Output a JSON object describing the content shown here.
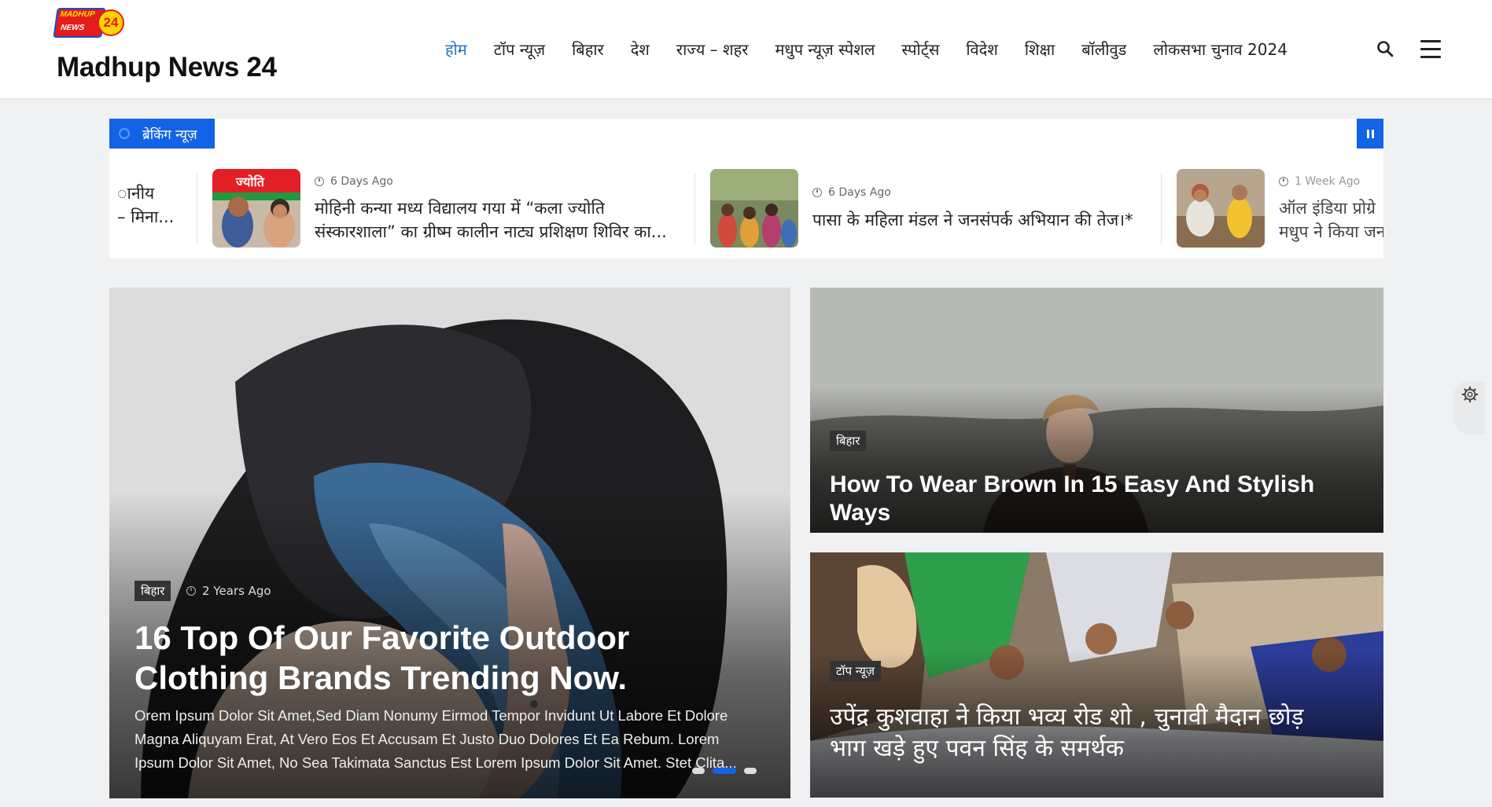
{
  "header": {
    "logo": {
      "line1": "MADHUP",
      "line2": "NEWS",
      "number": "24"
    },
    "site_title": "Madhup News 24",
    "nav": [
      {
        "label": "होम",
        "active": true
      },
      {
        "label": "टॉप न्यूज़"
      },
      {
        "label": "बिहार"
      },
      {
        "label": "देश"
      },
      {
        "label": "राज्य – शहर"
      },
      {
        "label": "मधुप न्यूज़ स्पेशल"
      },
      {
        "label": "स्पोर्ट्स"
      },
      {
        "label": "विदेश"
      },
      {
        "label": "शिक्षा"
      },
      {
        "label": "बॉलीवुड"
      },
      {
        "label": "लोकसभा चुनाव 2024"
      }
    ],
    "icons": [
      "search-icon",
      "menu-icon"
    ]
  },
  "breaking": {
    "label": "ब्रेकिंग न्यूज़",
    "items": [
      {
        "time": "",
        "title_line1": "ानीय",
        "title_line2": " – मिना..."
      },
      {
        "time": "6 Days Ago",
        "title_line1": "मोहिनी कन्या मध्य विद्यालय गया में “कला ज्योति",
        "title_line2": "संस्कारशाला” का  ग्रीष्म कालीन नाट्य प्रशिक्षण शिविर का..."
      },
      {
        "time": "6 Days Ago",
        "title_line1": "पासा के महिला मंडल ने जनसंपर्क अभियान की तेज।*",
        "title_line2": ""
      },
      {
        "time": "1 Week Ago",
        "title_line1": "ऑल इंडिया प्रोग्रे",
        "title_line2": "मधुप ने किया जन"
      }
    ]
  },
  "featured": {
    "category": "बिहार",
    "time": "2 Years Ago",
    "title_line1": "16 Top Of Our Favorite Outdoor",
    "title_line2": "Clothing Brands Trending Now.",
    "excerpt": "Orem Ipsum Dolor Sit Amet,Sed Diam Nonumy Eirmod Tempor Invidunt Ut Labore Et Dolore Magna Aliquyam Erat, At Vero Eos Et Accusam Et Justo Duo Dolores Et Ea Rebum. Lorem Ipsum Dolor Sit Amet, No Sea Takimata Sanctus Est Lorem Ipsum Dolor Sit Amet. Stet Clita...",
    "slider_active": 2
  },
  "side_top": {
    "category": "बिहार",
    "title": "How To Wear Brown In 15 Easy And Stylish Ways"
  },
  "side_bottom": {
    "category": "टॉप न्यूज़",
    "title_line1": "उपेंद्र कुशवाहा ने किया भव्य रोड शो , चुनावी मैदान छोड़",
    "title_line2": "भाग खड़े हुए पवन सिंह के समर्थक"
  },
  "colors": {
    "accent": "#1263e6",
    "nav_active": "#1d73c9",
    "badge": "#333333"
  }
}
